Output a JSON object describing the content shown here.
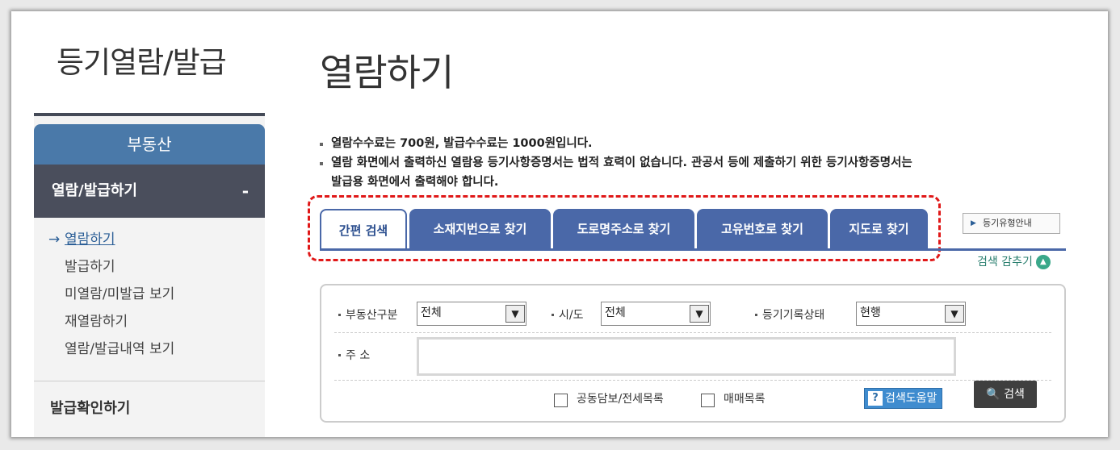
{
  "left_title": "등기열람/발급",
  "page_title": "열람하기",
  "sidebar": {
    "header": "부동산",
    "section": "열람/발급하기",
    "section_toggle": "-",
    "items": [
      {
        "label": "열람하기",
        "active": true,
        "arrow": "→"
      },
      {
        "label": "발급하기"
      },
      {
        "label": "미열람/미발급 보기"
      },
      {
        "label": "재열람하기"
      },
      {
        "label": "열람/발급내역 보기"
      }
    ],
    "bottom": "발급확인하기"
  },
  "notice": {
    "line1": "열람수수료는 700원, 발급수수료는 1000원입니다.",
    "line2a": "열람 화면에서 출력하신 열람용 등기사항증명서는 법적 효력이 없습니다. 관공서 등에 제출하기 위한 등기사항증명서는",
    "line2b": "발급용 화면에서 출력해야 합니다."
  },
  "tabs": [
    "간편 검색",
    "소재지번으로 찾기",
    "도로명주소로 찾기",
    "고유번호로 찾기",
    "지도로 찾기"
  ],
  "guide_button": "등기유형안내",
  "hide_search": "검색 감추기",
  "form": {
    "property_type_label": "부동산구분",
    "property_type_value": "전체",
    "city_label": "시/도",
    "city_value": "전체",
    "status_label": "등기기록상태",
    "status_value": "현행",
    "address_label": "주 소",
    "address_value": "",
    "checkbox1": "공동담보/전세목록",
    "checkbox2": "매매목록",
    "help_button": "검색도움말",
    "search_button": "검색"
  },
  "colors": {
    "tab_blue": "#4a68a8",
    "sidebar_header": "#4a79a9",
    "sidebar_section": "#4a4e5c",
    "highlight_red": "#e01818"
  }
}
